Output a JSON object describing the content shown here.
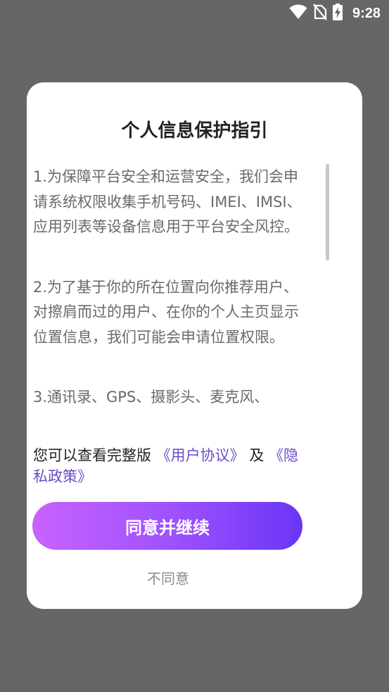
{
  "status_bar": {
    "time": "9:28",
    "icons": [
      "wifi-icon",
      "no-sim-icon",
      "battery-charging-icon"
    ]
  },
  "dialog": {
    "title": "个人信息保护指引",
    "paragraphs": [
      "1.为保障平台安全和运营安全，我们会申请系统权限收集手机号码、IMEI、IMSI、应用列表等设备信息用于平台安全风控。",
      "2.为了基于你的所在位置向你推荐用户、对擦肩而过的用户、在你的个人主页显示位置信息，我们可能会申请位置权限。",
      "3.通讯录、GPS、摄影头、麦克风、"
    ],
    "links_prefix": "您可以查看完整版",
    "user_agreement": "《用户协议》",
    "links_and": "及",
    "privacy_policy": "《隐私政策》",
    "agree_label": "同意并继续",
    "disagree_label": "不同意"
  },
  "colors": {
    "backdrop": "#666666",
    "link": "#6b4bc9",
    "button_gradient_start": "#c862ff",
    "button_gradient_end": "#6a35f6"
  }
}
